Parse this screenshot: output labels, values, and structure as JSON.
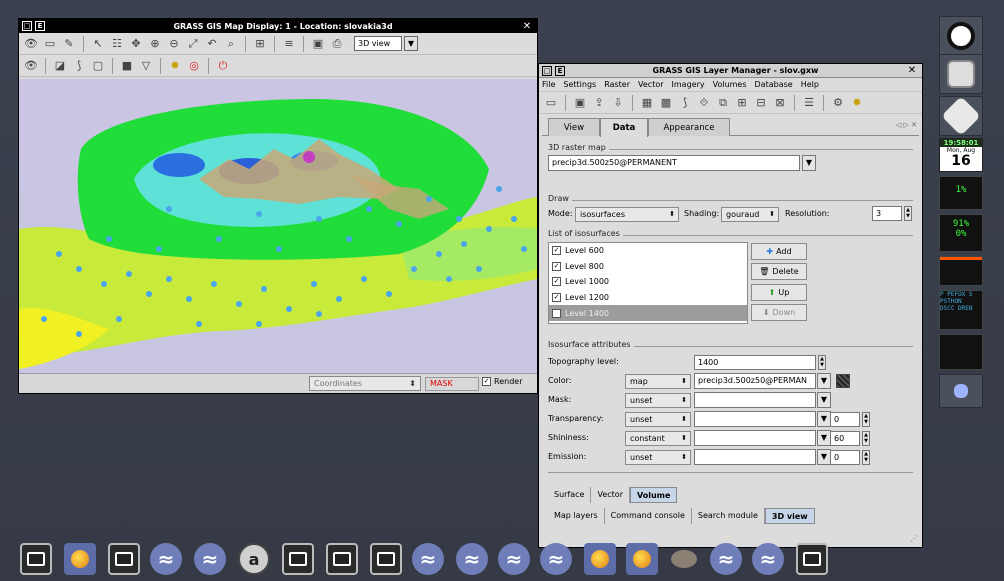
{
  "map_window": {
    "title": "GRASS GIS Map Display: 1  - Location: slovakia3d",
    "view_mode": "3D view",
    "status": {
      "coordinates": "Coordinates",
      "mask": "MASK",
      "render": "Render"
    }
  },
  "layer_manager": {
    "title": "GRASS GIS Layer Manager - slov.gxw",
    "menu": [
      "File",
      "Settings",
      "Raster",
      "Vector",
      "Imagery",
      "Volumes",
      "Database",
      "Help"
    ],
    "tabs": [
      "View",
      "Data",
      "Appearance"
    ],
    "raster_group": "3D raster map",
    "raster_map": "precip3d.500z50@PERMANENT",
    "draw_group": "Draw",
    "mode_label": "Mode:",
    "mode_value": "isosurfaces",
    "shading_label": "Shading:",
    "shading_value": "gouraud",
    "resolution_label": "Resolution:",
    "resolution_value": "3",
    "list_group": "List of isosurfaces",
    "isosurfaces": [
      "Level 600",
      "Level 800",
      "Level 1000",
      "Level 1200",
      "Level 1400"
    ],
    "buttons": {
      "add": "Add",
      "delete": "Delete",
      "up": "Up",
      "down": "Down"
    },
    "attr_group": "Isosurface attributes",
    "topography_label": "Topography level:",
    "topography_value": "1400",
    "color_label": "Color:",
    "color_mode": "map",
    "color_map": "precip3d.500z50@PERMAN",
    "mask_label": "Mask:",
    "mask_mode": "unset",
    "transparency_label": "Transparency:",
    "transparency_mode": "unset",
    "transparency_value": "0",
    "shininess_label": "Shininess:",
    "shininess_mode": "constant",
    "shininess_value": "60",
    "emission_label": "Emission:",
    "emission_mode": "unset",
    "emission_value": "0",
    "bottom_tabs_a": [
      "Surface",
      "Vector",
      "Volume"
    ],
    "bottom_tabs_b": [
      "Map layers",
      "Command console",
      "Search module",
      "3D view"
    ]
  },
  "dock": {
    "clock_time": "19:58:01",
    "date_dow": "Mon, Aug",
    "date_day": "16",
    "cpu_pct": "1%",
    "mem_a": "91%",
    "mem_b": "0%",
    "net_text": "P PEFOX S",
    "net_text2": "PSTHON",
    "net_text3": "DSCC DREN"
  },
  "colors": {
    "isosurface_green": "#22dd33",
    "isosurface_cyan": "#55e0e0",
    "terrain_yellow": "#e8f022",
    "selected_row": "#9c9c9c"
  }
}
